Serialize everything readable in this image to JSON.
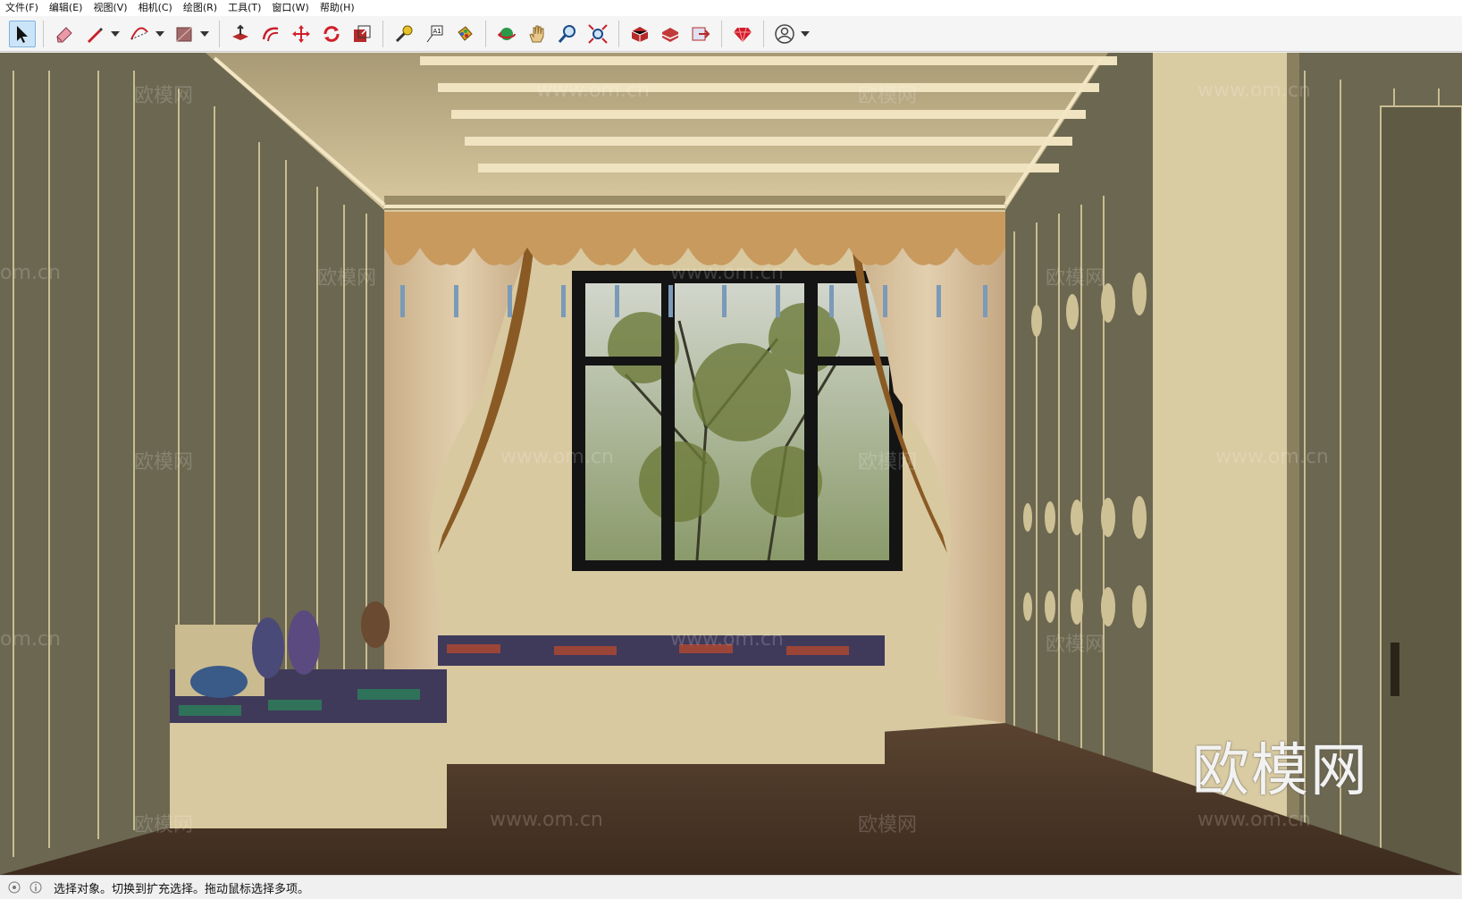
{
  "menu": [
    {
      "label": "文件(F)"
    },
    {
      "label": "编辑(E)"
    },
    {
      "label": "视图(V)"
    },
    {
      "label": "相机(C)"
    },
    {
      "label": "绘图(R)"
    },
    {
      "label": "工具(T)"
    },
    {
      "label": "窗口(W)"
    },
    {
      "label": "帮助(H)"
    }
  ],
  "toolbar": {
    "tools": [
      {
        "icon": "select-arrow-icon"
      },
      {
        "icon": "eraser-icon"
      },
      {
        "icon": "pencil-line-icon"
      },
      {
        "icon": "arc-icon"
      },
      {
        "icon": "rectangle-shape-icon"
      },
      {
        "icon": "push-pull-icon"
      },
      {
        "icon": "offset-icon"
      },
      {
        "icon": "move-icon"
      },
      {
        "icon": "rotate-icon"
      },
      {
        "icon": "scale-icon"
      },
      {
        "icon": "tape-measure-icon"
      },
      {
        "icon": "text-icon"
      },
      {
        "icon": "paint-bucket-icon"
      },
      {
        "icon": "orbit-icon"
      },
      {
        "icon": "pan-hand-icon"
      },
      {
        "icon": "zoom-icon"
      },
      {
        "icon": "zoom-extents-icon"
      },
      {
        "icon": "warehouse-icon"
      },
      {
        "icon": "extension-warehouse-icon"
      },
      {
        "icon": "send-to-layout-icon"
      },
      {
        "icon": "ruby-gem-icon"
      },
      {
        "icon": "account-icon"
      }
    ]
  },
  "viewport": {
    "watermarks": [
      "欧模网",
      "www.om.cn",
      "om.cn"
    ],
    "logo_text": "欧模网",
    "colors": {
      "wall": "#6f6a51",
      "ceiling": "#c9b98f",
      "curtain": "#d8c3a0",
      "valance": "#c79a5e",
      "floor": "#4c3829",
      "sofa": "#d9c9a0"
    }
  },
  "status": {
    "message": "选择对象。切换到扩充选择。拖动鼠标选择多项。"
  }
}
